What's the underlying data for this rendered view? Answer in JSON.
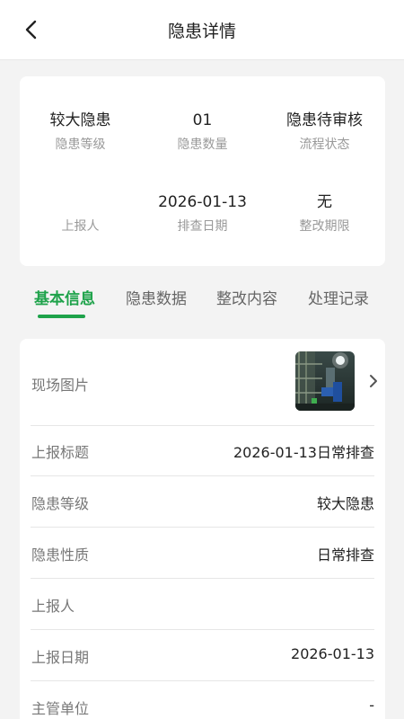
{
  "header": {
    "title": "隐患详情"
  },
  "summary": {
    "level": {
      "value": "较大隐患",
      "label": "隐患等级"
    },
    "count": {
      "value": "01",
      "label": "隐患数量"
    },
    "status": {
      "value": "隐患待审核",
      "label": "流程状态"
    },
    "reporter": {
      "value": "",
      "label": "上报人"
    },
    "date": {
      "value": "2026-01-13",
      "label": "排查日期"
    },
    "deadline": {
      "value": "无",
      "label": "整改期限"
    }
  },
  "tabs": [
    {
      "label": "基本信息"
    },
    {
      "label": "隐患数据"
    },
    {
      "label": "整改内容"
    },
    {
      "label": "处理记录"
    }
  ],
  "details": {
    "photo_label": "现场图片",
    "rows": [
      {
        "key": "上报标题",
        "value": "2026-01-13日常排查"
      },
      {
        "key": "隐患等级",
        "value": "较大隐患"
      },
      {
        "key": "隐患性质",
        "value": "日常排查"
      },
      {
        "key": "上报人",
        "value": ""
      },
      {
        "key": "上报日期",
        "value": "2026-01-13"
      },
      {
        "key": "主管单位",
        "value": "-"
      }
    ]
  },
  "colors": {
    "accent": "#1ea24a"
  }
}
